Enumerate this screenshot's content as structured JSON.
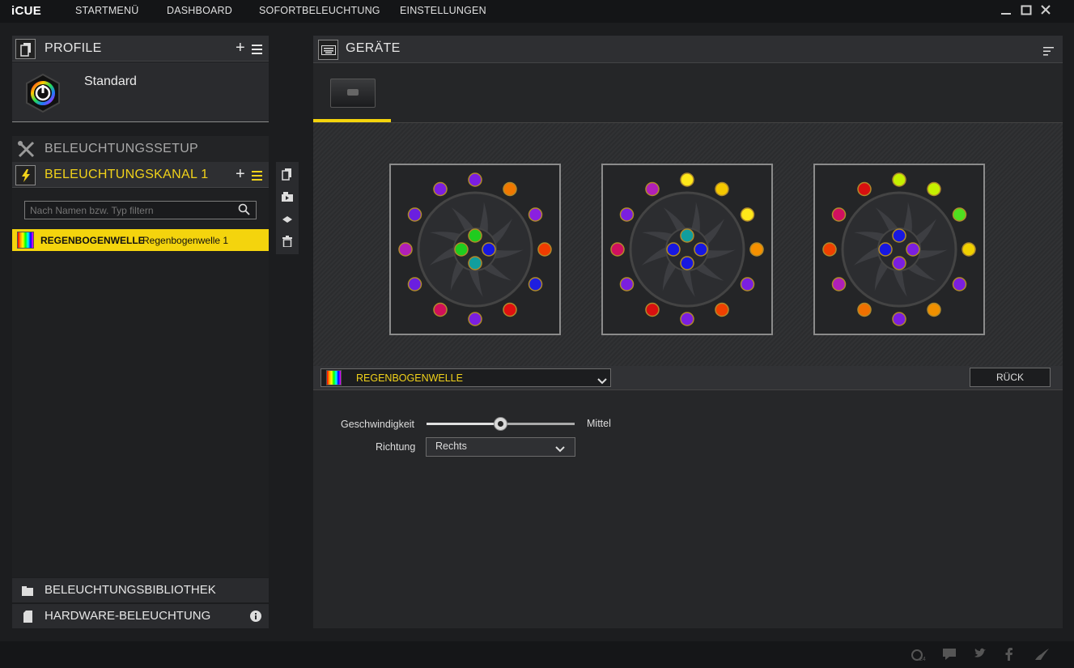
{
  "app": {
    "title": "iCUE"
  },
  "nav": [
    "STARTMENÜ",
    "DASHBOARD",
    "SOFORTBELEUCHTUNG",
    "EINSTELLUNGEN"
  ],
  "window_controls": {
    "minimize": "—",
    "maximize": "☐",
    "close": "✕"
  },
  "profile_panel": {
    "title": "PROFILE",
    "add_label": "+",
    "menu_label": "≡",
    "profile_name": "Standard"
  },
  "lighting_setup": {
    "title": "BELEUCHTUNGSSETUP"
  },
  "lighting_channel": {
    "title": "BELEUCHTUNGSKANAL 1",
    "add_label": "+",
    "menu_label": "≡",
    "filter_placeholder": "Nach Namen bzw. Typ filtern",
    "items": [
      {
        "type": "REGENBOGENWELLE",
        "name": "Regenbogenwelle 1"
      }
    ]
  },
  "bottom": {
    "library": "BELEUCHTUNGSBIBLIOTHEK",
    "hardware": "HARDWARE-BELEUCHTUNG"
  },
  "devices_panel": {
    "title": "GERÄTE"
  },
  "fans": [
    {
      "outer": [
        "#7B1FE0",
        "#F07800",
        "#8A1FE0",
        "#F03C00",
        "#1E1EE0",
        "#E01010",
        "#7B1FE0",
        "#D0105A",
        "#6A1FE0",
        "#B020B8",
        "#6A1FE0",
        "#7B1FE0"
      ],
      "inner": [
        "#1FCC1F",
        "#1FCC1F",
        "#1818E0",
        "#119E9E"
      ]
    },
    {
      "outer": [
        "#FFE81A",
        "#F5C800",
        "#FFE81A",
        "#F59000",
        "#7B1FE0",
        "#F04000",
        "#7B1FE0",
        "#D81010",
        "#7B1FE0",
        "#D01060",
        "#7B1FE0",
        "#B020B8"
      ],
      "inner": [
        "#119E9E",
        "#1818E0",
        "#1818E0",
        "#1818E0"
      ]
    },
    {
      "outer": [
        "#C6F000",
        "#C6F000",
        "#4FE020",
        "#F0D000",
        "#7B1FE0",
        "#F09000",
        "#7B1FE0",
        "#F07000",
        "#B020B8",
        "#F04000",
        "#D01060",
        "#D81010"
      ],
      "inner": [
        "#1818E0",
        "#1818E0",
        "#7B1FE0",
        "#7B1FE0"
      ]
    }
  ],
  "effect": {
    "selected": "REGENBOGENWELLE",
    "back_label": "RÜCK",
    "speed_label": "Geschwindigkeit",
    "speed_value_label": "Mittel",
    "speed_fraction": 0.5,
    "direction_label": "Richtung",
    "direction_value": "Rechts"
  },
  "colors": {
    "accent": "#F4D40D"
  }
}
